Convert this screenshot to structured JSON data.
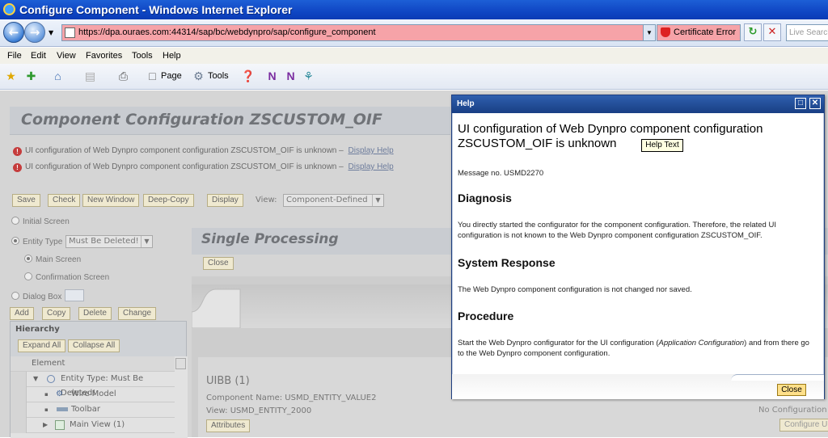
{
  "window": {
    "title": "Configure Component - Windows Internet Explorer"
  },
  "address": {
    "url": "https://dpa.ouraes.com:44314/sap/bc/webdynpro/sap/configure_component",
    "cert_error": "Certificate Error",
    "live_search_placeholder": "Live Search"
  },
  "menu": [
    "File",
    "Edit",
    "View",
    "Favorites",
    "Tools",
    "Help"
  ],
  "toolbar": {
    "page_label": "Page",
    "tools_label": "Tools"
  },
  "page": {
    "component_title": "Component Configuration ZSCUSTOM_OIF",
    "messages": [
      {
        "text": "UI configuration of Web Dynpro component configuration ZSCUSTOM_OIF is unknown",
        "link": "Display Help"
      },
      {
        "text": "UI configuration of Web Dynpro component configuration ZSCUSTOM_OIF is unknown",
        "link": "Display Help"
      }
    ],
    "buttons": {
      "save": "Save",
      "check": "Check",
      "new_window": "New Window",
      "deep_copy": "Deep-Copy",
      "display": "Display"
    },
    "view_label": "View:",
    "view_value": "Component-Defined",
    "radios": {
      "initial_screen": "Initial Screen",
      "entity_type": "Entity Type",
      "main_screen": "Main Screen",
      "confirmation_screen": "Confirmation Screen",
      "dialog_box": "Dialog Box"
    },
    "entity_type_value": "Must Be Deleted!",
    "actions": {
      "add": "Add",
      "copy": "Copy",
      "delete": "Delete",
      "change": "Change"
    },
    "hierarchy": {
      "title": "Hierarchy",
      "expand_all": "Expand All",
      "collapse_all": "Collapse All",
      "column": "Element",
      "rows": [
        "Entity Type: Must Be Deleted!",
        "Wire Model",
        "Toolbar",
        "Main View (1)"
      ]
    },
    "single_processing": {
      "title": "Single Processing",
      "close": "Close"
    },
    "uibb": {
      "title": "UIBB (1)",
      "component_name": "Component Name: USMD_ENTITY_VALUE2",
      "view": "View: USMD_ENTITY_2000",
      "attributes": "Attributes"
    },
    "right_partial": {
      "no_config": "No Configuration N",
      "configure": "Configure U"
    }
  },
  "help": {
    "header": "Help",
    "title": "UI configuration of Web Dynpro component configuration ZSCUSTOM_OIF is unknown",
    "message_no": "Message no. USMD2270",
    "diagnosis_heading": "Diagnosis",
    "diagnosis_text": "You directly started the configurator for the component configuration. Therefore, the related UI configuration is not known to the Web Dynpro component configuration ZSCUSTOM_OIF.",
    "system_response_heading": "System Response",
    "system_response_text": "The Web Dynpro component configuration is not changed nor saved.",
    "procedure_heading": "Procedure",
    "procedure_pre": "Start the Web Dynpro configurator for the UI configuration (",
    "procedure_italic": "Application Configuration",
    "procedure_post": ") and from there go to the Web Dynpro component configuration.",
    "close": "Close",
    "tooltip": "Help Text"
  }
}
